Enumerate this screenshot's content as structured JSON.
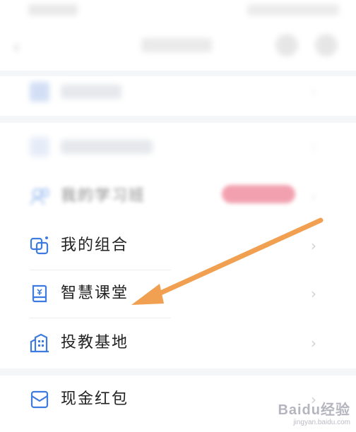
{
  "menu": {
    "items": [
      {
        "label": "我的组合",
        "icon": "combination-icon"
      },
      {
        "label": "智慧课堂",
        "icon": "book-icon"
      },
      {
        "label": "投教基地",
        "icon": "building-icon"
      },
      {
        "label": "现金红包",
        "icon": "envelope-icon"
      }
    ]
  },
  "blurred": {
    "study_class_label": "我的学习班"
  },
  "colors": {
    "accent": "#3d7be0",
    "arrow": "#f0a050",
    "badge": "#e8546f",
    "band": "#f5f6f8"
  },
  "watermark": {
    "logo": "Baidu经验",
    "url": "jingyan.baidu.com"
  }
}
